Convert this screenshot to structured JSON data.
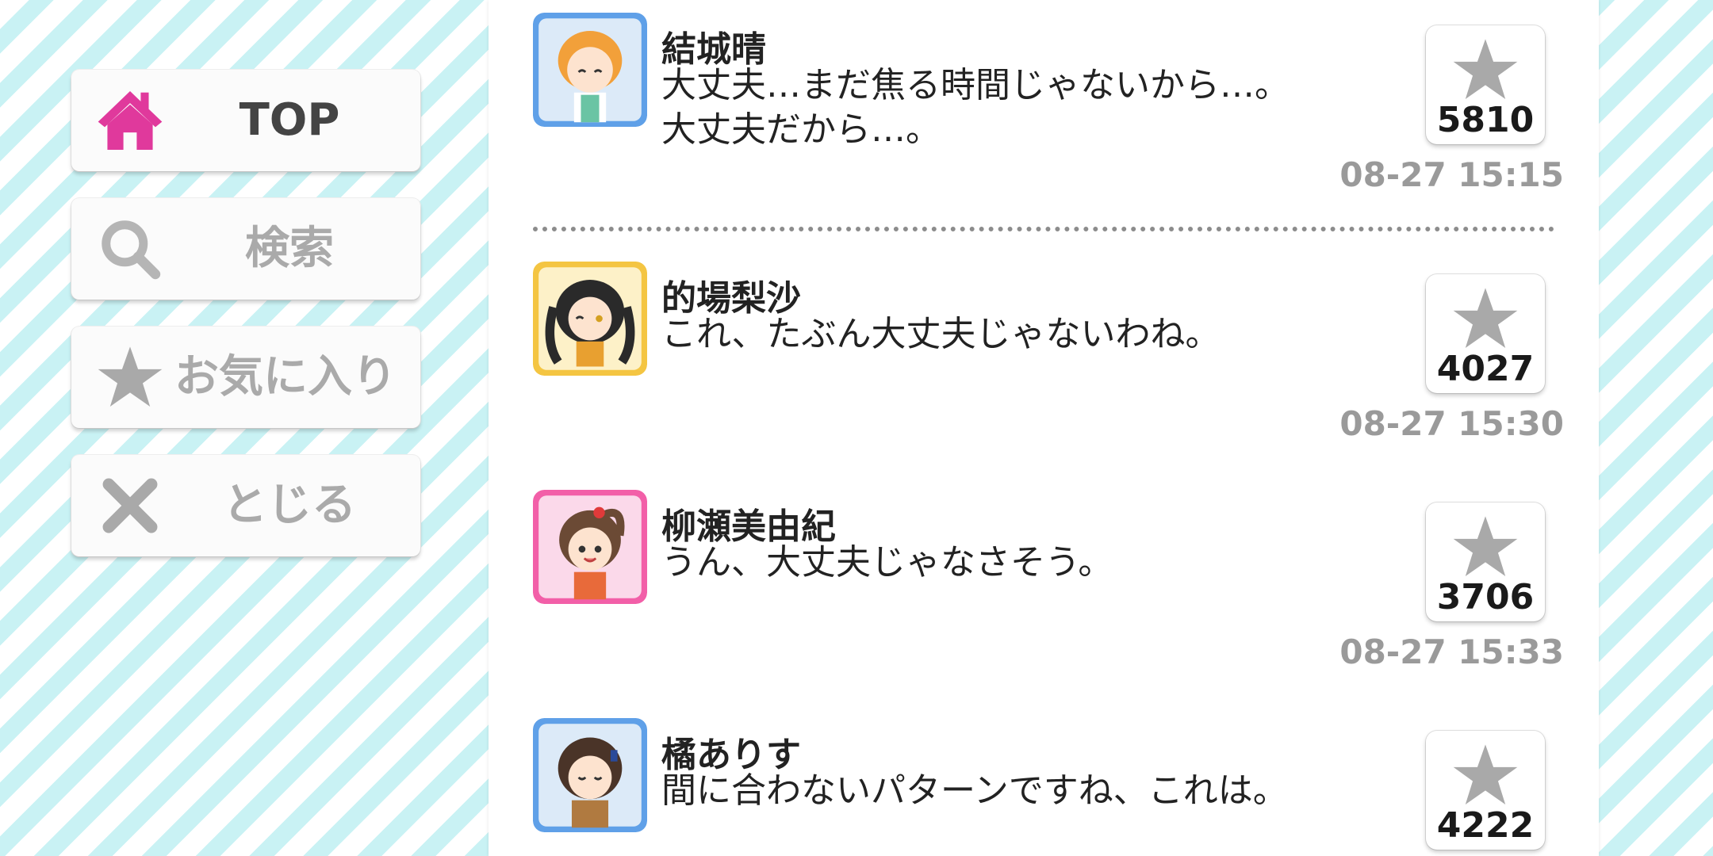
{
  "menu": {
    "top": {
      "label": "TOP",
      "icon": "home-icon",
      "color": "#e0399c"
    },
    "search": {
      "label": "検索",
      "icon": "search-icon",
      "color": "#aaaaaa"
    },
    "favorites": {
      "label": "お気に入り",
      "icon": "star-icon",
      "color": "#aaaaaa"
    },
    "close": {
      "label": "とじる",
      "icon": "close-icon",
      "color": "#aaaaaa"
    }
  },
  "entries": [
    {
      "name": "結城晴",
      "message_lines": [
        "大丈夫…まだ焦る時間じゃないから…。",
        "大丈夫だから…。"
      ],
      "favorite_count": "5810",
      "timestamp": "08-27 15:15",
      "avatar_frame": "#5fa0e8"
    },
    {
      "name": "的場梨沙",
      "message_lines": [
        "これ、たぶん大丈夫じゃないわね。"
      ],
      "favorite_count": "4027",
      "timestamp": "08-27 15:30",
      "avatar_frame": "#f4c542"
    },
    {
      "name": "柳瀬美由紀",
      "message_lines": [
        "うん、大丈夫じゃなさそう。"
      ],
      "favorite_count": "3706",
      "timestamp": "08-27 15:33",
      "avatar_frame": "#f25fa8"
    },
    {
      "name": "橘ありす",
      "message_lines": [
        "間に合わないパターンですね、これは。"
      ],
      "favorite_count": "4222",
      "timestamp": "",
      "avatar_frame": "#5fa0e8"
    }
  ],
  "colors": {
    "accent": "#e0399c",
    "star_gray": "#a9a9a9",
    "stripe": "#c9f2f4"
  }
}
